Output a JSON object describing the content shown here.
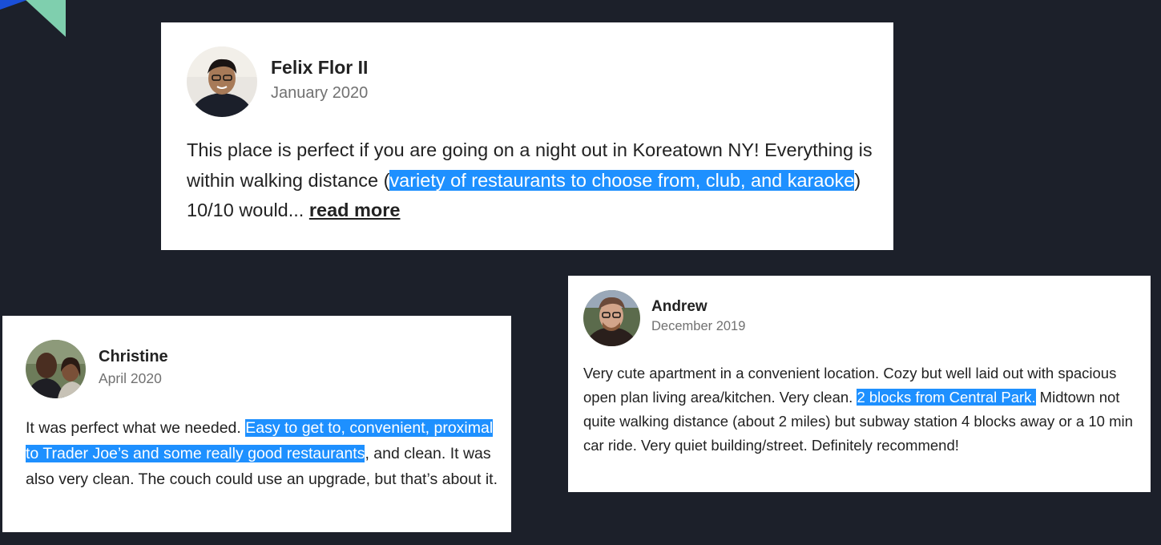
{
  "colors": {
    "background": "#1c202a",
    "card": "#ffffff",
    "highlight": "#1e90ff",
    "corner_blue": "#1a4fd8",
    "corner_green": "#7fcfae"
  },
  "reviews": [
    {
      "name": "Felix Flor II",
      "date": "January 2020",
      "text_1": "This place is perfect if you are going on a night out in Koreatown NY! Everything is within walking distance (",
      "highlight": "variety of restaurants to choose from, club, and karaoke",
      "text_2": ") 10/10 would... ",
      "link": "read more"
    },
    {
      "name": "Christine",
      "date": "April 2020",
      "text_1": "It was perfect what we needed. ",
      "highlight": "Easy to get to, convenient, proximal to Trader Joe’s and some really good restaurants",
      "text_2": ", and clean. It was also very clean. The couch could use an upgrade, but that’s about it."
    },
    {
      "name": "Andrew",
      "date": "December 2019",
      "text_1": "Very cute apartment in a convenient location. Cozy but well laid out with spacious open plan living area/kitchen. Very clean. ",
      "highlight": "2 blocks from Central Park.",
      "text_2": " Midtown not quite walking distance (about 2 miles) but subway station 4 blocks away or a 10 min car ride. Very quiet building/street. Definitely recommend!"
    }
  ]
}
